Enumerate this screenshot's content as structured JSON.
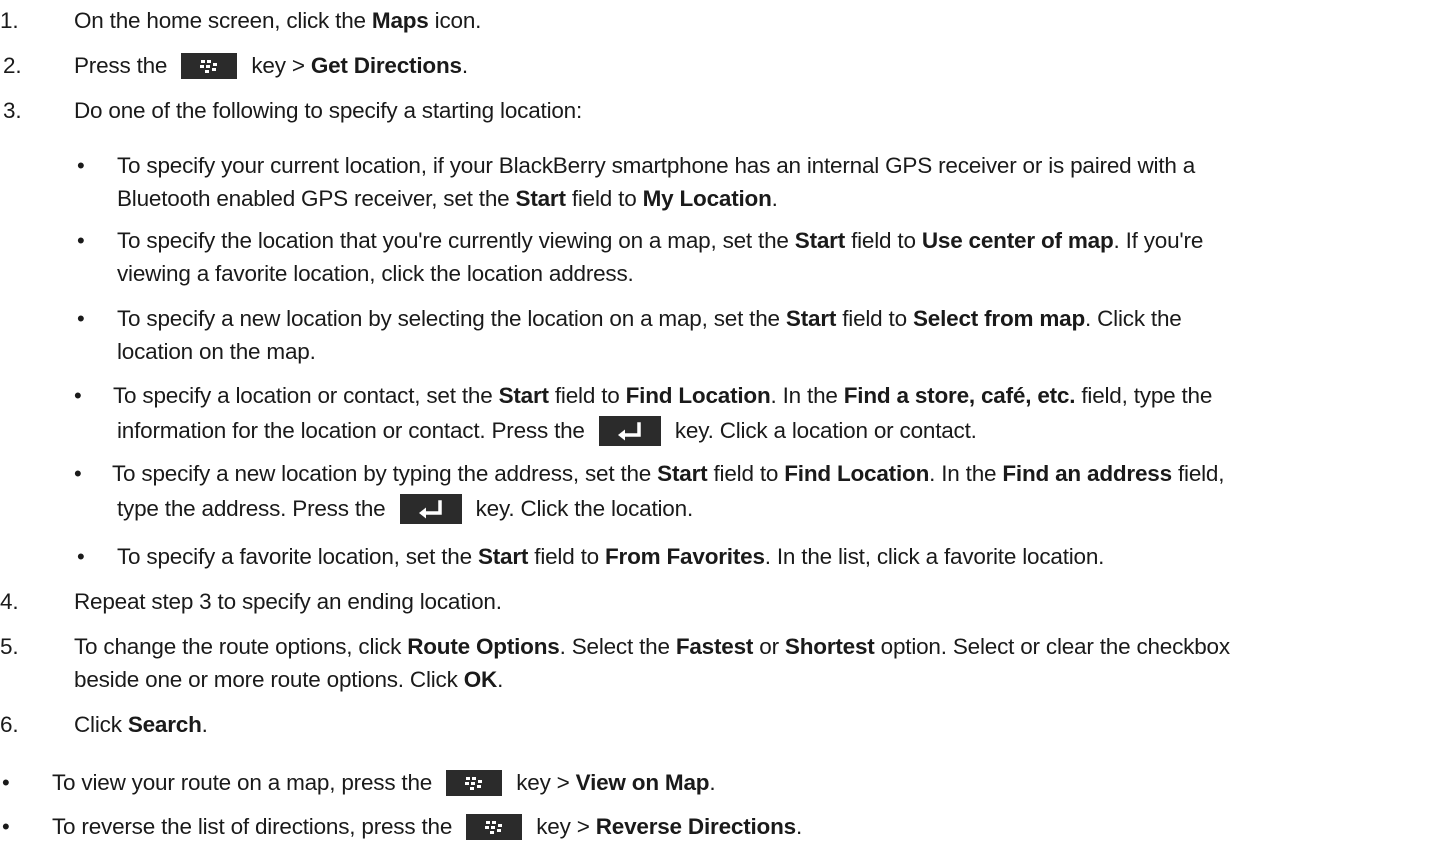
{
  "steps": [
    {
      "num": "1.",
      "parts": [
        "On the home screen, click the ",
        "Maps",
        " icon."
      ]
    },
    {
      "num": "2.",
      "parts": [
        "Press the ",
        " key > ",
        "Get Directions",
        "."
      ]
    },
    {
      "num": "3.",
      "parts": [
        "Do one of the following to specify a starting location:"
      ]
    },
    {
      "num": "4.",
      "parts": [
        "Repeat step 3 to specify an ending location."
      ]
    },
    {
      "num": "5.",
      "lines": [
        [
          "To change the route options, click ",
          "Route Options",
          ". Select the ",
          "Fastest",
          " or ",
          "Shortest",
          " option. Select or clear the checkbox"
        ],
        [
          "beside one or more route options. Click ",
          "OK",
          "."
        ]
      ]
    },
    {
      "num": "6.",
      "parts": [
        "Click ",
        "Search",
        "."
      ]
    }
  ],
  "sub_bullets": [
    {
      "lines": [
        [
          "To specify your current location, if your BlackBerry smartphone has an internal GPS receiver or is paired with a"
        ],
        [
          "Bluetooth enabled GPS receiver, set the ",
          "Start",
          " field to ",
          "My Location",
          "."
        ]
      ]
    },
    {
      "lines": [
        [
          "To specify the location that you're currently viewing on a map, set the ",
          "Start",
          " field to ",
          "Use center of map",
          ". If you're"
        ],
        [
          "viewing a favorite location, click the location address."
        ]
      ]
    },
    {
      "lines": [
        [
          "To specify a new location by selecting the location on a map, set the ",
          "Start",
          " field to ",
          "Select from map",
          ". Click the"
        ],
        [
          "location on the map."
        ]
      ]
    },
    {
      "lines": [
        [
          "To specify a location or contact, set the ",
          "Start",
          " field to ",
          "Find Location",
          ". In the ",
          "Find a store, café, etc.",
          " field, type the"
        ],
        [
          "information for the location or contact. Press the ",
          " key. Click a location or contact."
        ]
      ]
    },
    {
      "lines": [
        [
          "To specify a new location by typing the address, set the ",
          "Start",
          " field to ",
          "Find Location",
          ". In the ",
          "Find an address",
          " field,"
        ],
        [
          "type the address. Press the ",
          " key. Click the location."
        ]
      ]
    },
    {
      "lines": [
        [
          "To specify a favorite location, set the ",
          "Start",
          " field to ",
          "From Favorites",
          ". In the list, click a favorite location."
        ]
      ]
    }
  ],
  "tips": [
    {
      "parts": [
        "To view your route on a map, press the ",
        " key > ",
        "View on Map",
        "."
      ]
    },
    {
      "parts": [
        "To reverse the list of directions, press the ",
        " key > ",
        "Reverse Directions",
        "."
      ]
    }
  ],
  "bullet_char": "•",
  "icons": {
    "menu_key": "blackberry-menu-key-icon",
    "enter_key": "enter-key-icon"
  },
  "colors": {
    "text": "#1a1a1a",
    "key_bg": "#2b2b2b",
    "key_fg": "#ffffff"
  }
}
